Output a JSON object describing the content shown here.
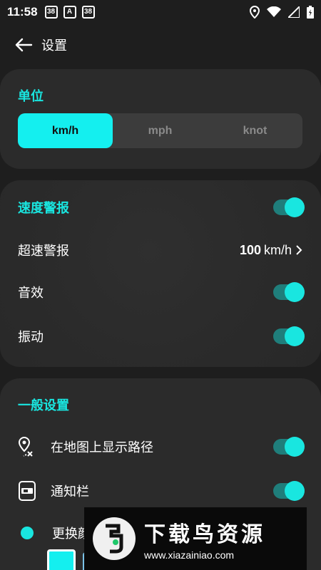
{
  "status_bar": {
    "time": "11:58",
    "notif_icons": [
      "38",
      "A",
      "38"
    ]
  },
  "header": {
    "title": "设置"
  },
  "units": {
    "section_title": "单位",
    "options": [
      "km/h",
      "mph",
      "knot"
    ],
    "selected": "km/h"
  },
  "speed_alert": {
    "section_title": "速度警报",
    "section_toggle_on": true,
    "overspeed_label": "超速警报",
    "overspeed_value": "100",
    "overspeed_unit": "km/h",
    "sound_label": "音效",
    "sound_on": true,
    "vibration_label": "振动",
    "vibration_on": true
  },
  "general": {
    "section_title": "一般设置",
    "show_route_label": "在地图上显示路径",
    "show_route_on": true,
    "notification_label": "通知栏",
    "notification_on": true,
    "change_color_label": "更换颜",
    "swatch_colors": [
      "#14efef",
      "#7bc3e8",
      "#8bd000",
      "#f5e600",
      "#ff7043",
      "#ff4d6d",
      "#b07cff",
      "#ffffff"
    ]
  },
  "watermark": {
    "title": "下载鸟资源",
    "url": "www.xiazainiao.com"
  },
  "colors": {
    "accent": "#19e6e0",
    "background": "#1e1e1e",
    "card": "#2b2b2b"
  }
}
